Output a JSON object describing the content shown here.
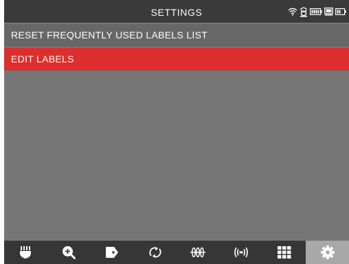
{
  "header": {
    "title": "SETTINGS",
    "status_icons": [
      "wifi-icon",
      "gps-icon",
      "battery-icon",
      "screen-icon",
      "device-battery-icon"
    ]
  },
  "menu": {
    "items": [
      {
        "label": "RESET FREQUENTLY USED LABELS LIST",
        "selected": false
      },
      {
        "label": "EDIT LABELS",
        "selected": true
      }
    ]
  },
  "toolbar": {
    "tabs": [
      {
        "icon": "utility-locator-icon",
        "active": false
      },
      {
        "icon": "zoom-in-icon",
        "active": false
      },
      {
        "icon": "label-tag-icon",
        "active": false
      },
      {
        "icon": "refresh-icon",
        "active": false
      },
      {
        "icon": "frequency-waves-icon",
        "active": false
      },
      {
        "icon": "broadcast-icon",
        "active": false
      },
      {
        "icon": "grid-icon",
        "active": false
      },
      {
        "icon": "settings-gear-icon",
        "active": true
      }
    ]
  },
  "colors": {
    "header_bg": "#3a3a3a",
    "content_bg": "#767676",
    "row_bg": "#676767",
    "selected_row": "#de2d2d",
    "toolbar_bg": "#363636",
    "active_tab": "#a8a8a8"
  }
}
